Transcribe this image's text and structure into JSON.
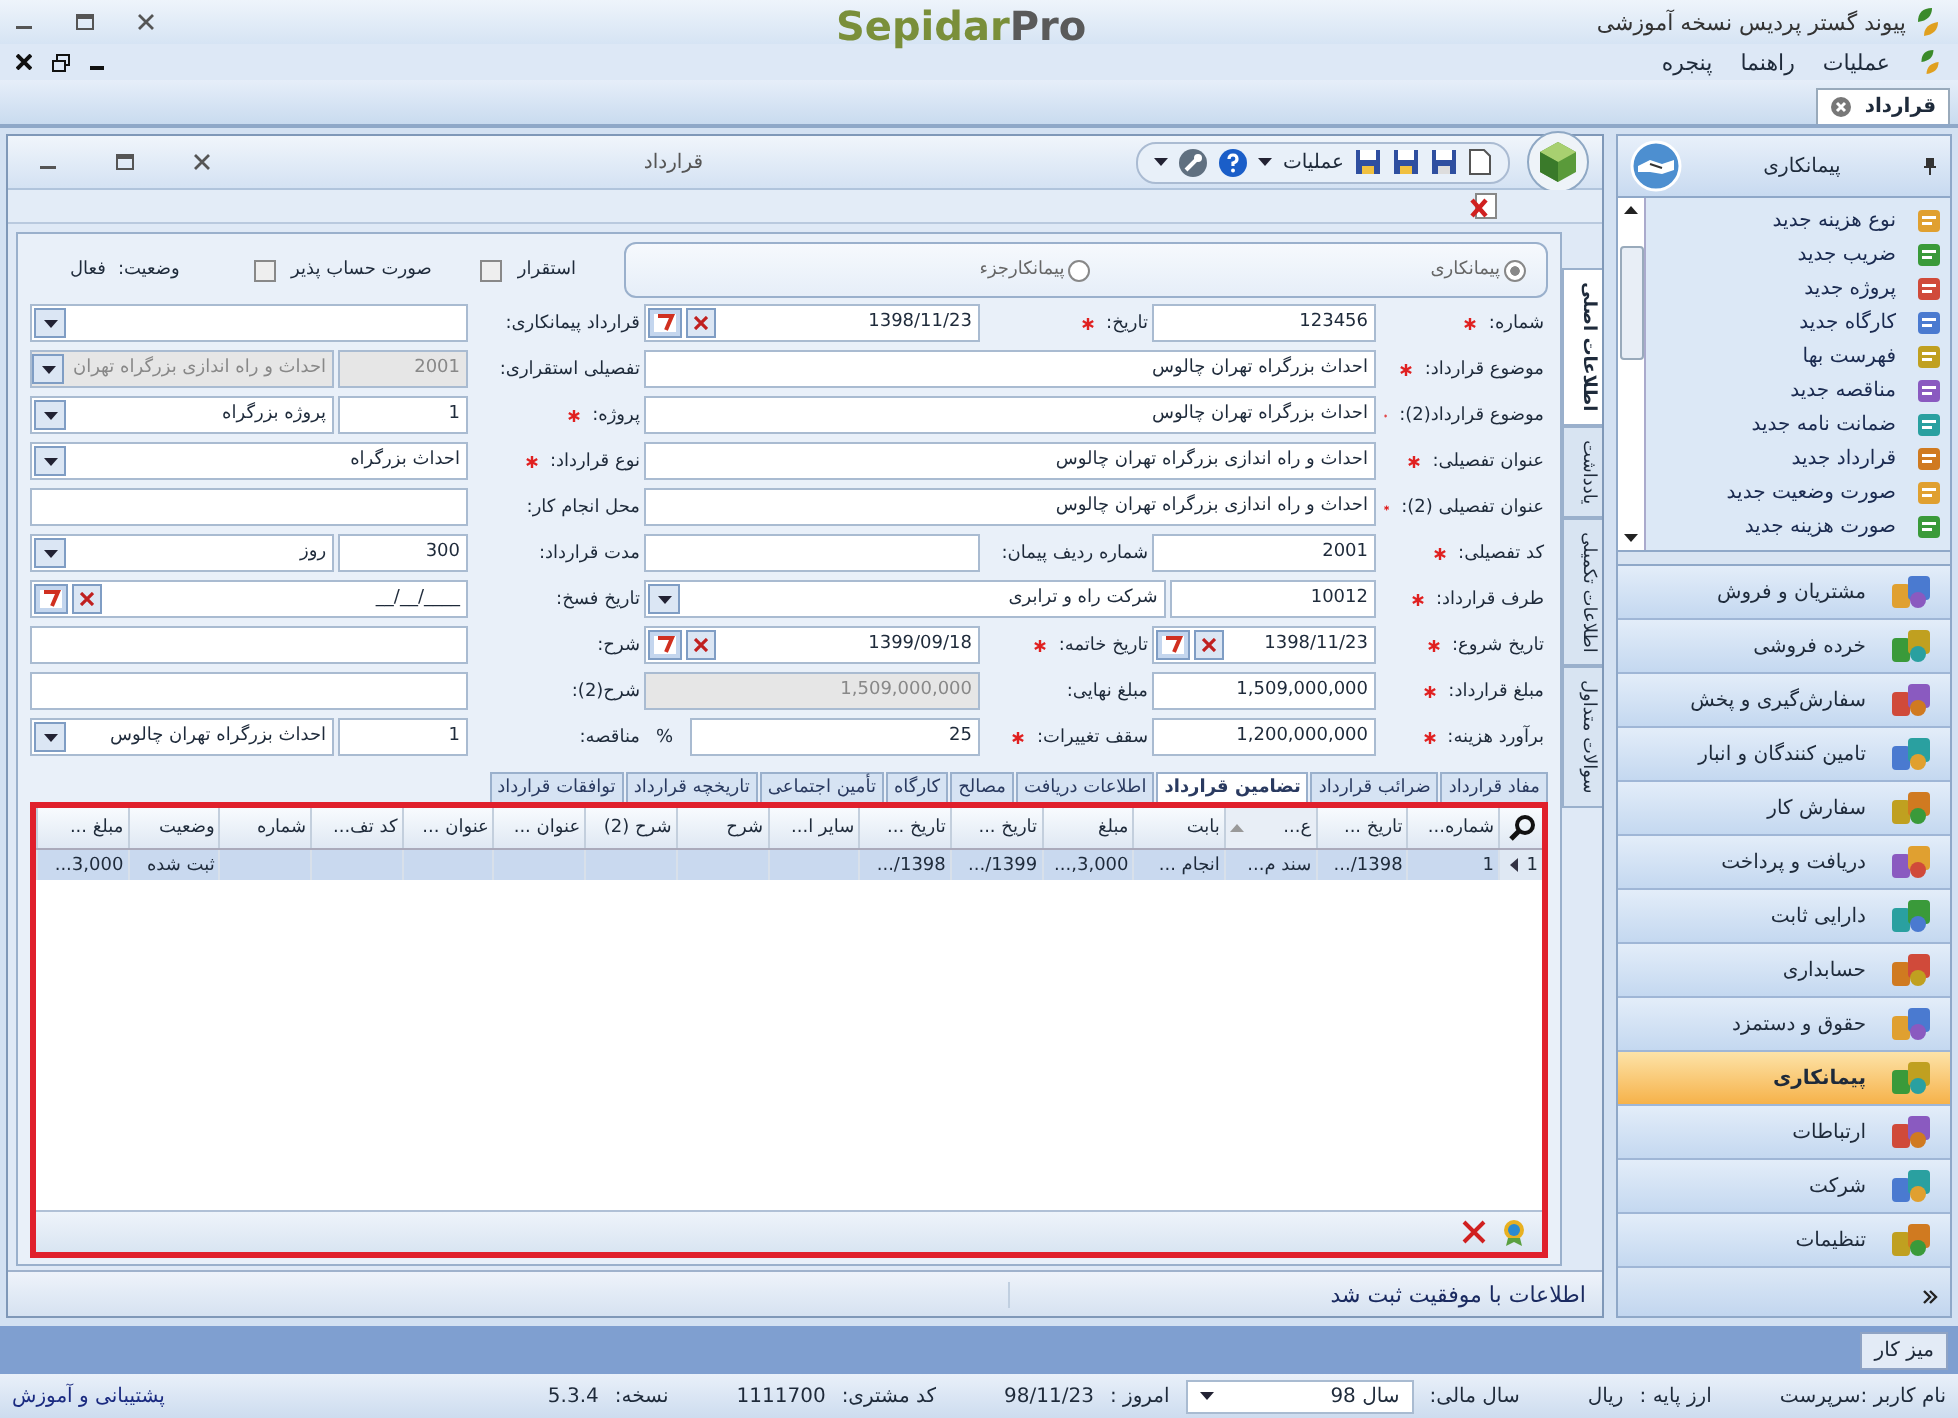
{
  "app_title": "پیوند گستر پردیس نسخه آموزشی",
  "brand": {
    "first": "Sepidar",
    "second": "Pro"
  },
  "menu": [
    "عملیات",
    "راهنما",
    "پنجره"
  ],
  "doc_tabs": [
    {
      "label": "قرارداد",
      "selected": true
    }
  ],
  "form": {
    "title": "قرارداد",
    "toolbar_menu": "عملیات",
    "contract_types": [
      {
        "label": "پیمانکاری",
        "selected": true
      },
      {
        "label": "پیمانکارجزء",
        "selected": false
      }
    ],
    "flags": [
      {
        "label": "استقرار",
        "checked": false
      },
      {
        "label": "صورت حساب پذیر",
        "checked": false
      }
    ],
    "status": {
      "label": "وضعیت:",
      "value": "فعال"
    },
    "rows": [
      [
        {
          "label": "شماره:",
          "required": true,
          "kind": "text",
          "disabled": false,
          "value": "123456"
        },
        {
          "label": "تاریخ:",
          "required": true,
          "kind": "date",
          "disabled": false,
          "value": "1398/11/23"
        },
        {
          "label": "قرارداد پیمانکاری:",
          "required": false,
          "kind": "combo",
          "disabled": false
        }
      ],
      [
        {
          "label": "موضوع قرارداد:",
          "required": true,
          "kind": "text",
          "disabled": false,
          "value": "احداث بزرگراه تهران چالوس"
        },
        {
          "label": "تفصیلی استقراری:",
          "required": false,
          "kind": "code_combo",
          "disabled": true,
          "code": "2001",
          "value": "احداث و راه اندازی بزرگراه تهران"
        }
      ],
      [
        {
          "label": "موضوع قرارداد(2):",
          "required": true,
          "kind": "text",
          "disabled": false,
          "value": "احداث بزرگراه تهران چالوس"
        },
        {
          "label": "پروژه:",
          "required": true,
          "kind": "code_combo",
          "disabled": false,
          "code": "1",
          "value": "پروژه بزرگراه"
        }
      ],
      [
        {
          "label": "عنوان تفصیلی:",
          "required": true,
          "kind": "text",
          "disabled": false,
          "value": "احداث و راه اندازی بزرگراه تهران چالوس"
        },
        {
          "label": "نوع قرارداد:",
          "required": true,
          "kind": "combo",
          "disabled": false,
          "value": "احداث بزرگراه"
        }
      ],
      [
        {
          "label": "عنوان تفصیلی (2):",
          "required": true,
          "kind": "text",
          "disabled": false,
          "value": "احداث و راه اندازی بزرگراه تهران چالوس"
        },
        {
          "label": "محل انجام کار:",
          "required": false,
          "kind": "text",
          "disabled": false
        }
      ],
      [
        {
          "label": "کد تفصیلی:",
          "required": true,
          "kind": "text",
          "disabled": false,
          "value": "2001"
        },
        {
          "label": "شماره ردیف پیمان:",
          "required": false,
          "kind": "text",
          "disabled": false
        },
        {
          "label": "مدت قرارداد:",
          "required": false,
          "kind": "code_combo",
          "disabled": false,
          "code": "300",
          "value": "روز"
        }
      ],
      [
        {
          "label": "طرف قرارداد:",
          "required": true,
          "kind": "code_combo",
          "disabled": false,
          "code": "10012",
          "value": "شرکت راه و ترابری"
        },
        {
          "label": "تاریخ فسخ:",
          "required": false,
          "kind": "date",
          "disabled": false,
          "value": "__/__/____"
        }
      ],
      [
        {
          "label": "تاریخ شروع:",
          "required": true,
          "kind": "date",
          "disabled": false,
          "value": "1398/11/23"
        },
        {
          "label": "تاریخ خاتمه:",
          "required": true,
          "kind": "date",
          "disabled": false,
          "value": "1399/09/18"
        },
        {
          "label": "شرح:",
          "required": false,
          "kind": "text",
          "disabled": false
        }
      ],
      [
        {
          "label": "مبلغ قرارداد:",
          "required": true,
          "kind": "text",
          "disabled": false,
          "value": "1,509,000,000"
        },
        {
          "label": "مبلغ نهایی:",
          "required": false,
          "kind": "text",
          "disabled": true,
          "value": "1,509,000,000"
        },
        {
          "label": "شرح(2):",
          "required": false,
          "kind": "text",
          "disabled": false
        }
      ],
      [
        {
          "label": "برآورد هزینه:",
          "required": true,
          "kind": "text",
          "disabled": false,
          "value": "1,200,000,000"
        },
        {
          "label": "سقف تغییرات:",
          "required": true,
          "kind": "text",
          "disabled": false,
          "value": "25",
          "suffix": "%"
        },
        {
          "label": "مناقصه:",
          "required": false,
          "kind": "code_combo",
          "disabled": false,
          "code": "1",
          "value": "احداث بزرگراه تهران چالوس"
        }
      ]
    ],
    "side_tabs": [
      {
        "label": "اطلاعات اصلی",
        "selected": true
      },
      {
        "label": "یادداشت",
        "selected": false
      },
      {
        "label": "اطلاعات تکمیلی",
        "selected": false
      },
      {
        "label": "سوالات متداول",
        "selected": false
      }
    ],
    "tabs": [
      {
        "label": "مفاد قرارداد",
        "selected": false
      },
      {
        "label": "ضرائب قرارداد",
        "selected": false
      },
      {
        "label": "تضامین قرارداد",
        "selected": true
      },
      {
        "label": "اطلاعات دریافت",
        "selected": false
      },
      {
        "label": "مصالح",
        "selected": false
      },
      {
        "label": "کارگاه",
        "selected": false
      },
      {
        "label": "تأمین اجتماعی",
        "selected": false
      },
      {
        "label": "تاریخچه قرارداد",
        "selected": false
      },
      {
        "label": "توافقات قرارداد",
        "selected": false
      }
    ],
    "grid": {
      "columns": [
        {
          "label": "شماره...",
          "sorted": false
        },
        {
          "label": "تاریخ ...",
          "sorted": false
        },
        {
          "label": "ع...",
          "sorted": true
        },
        {
          "label": "بابت",
          "sorted": false
        },
        {
          "label": "مبلغ",
          "sorted": false
        },
        {
          "label": "تاریخ ...",
          "sorted": false
        },
        {
          "label": "تاریخ ...",
          "sorted": false
        },
        {
          "label": "سایر ا...",
          "sorted": false
        },
        {
          "label": "شرح",
          "sorted": false
        },
        {
          "label": "شرح (2)",
          "sorted": false
        },
        {
          "label": "عنوان ...",
          "sorted": false
        },
        {
          "label": "عنوان ...",
          "sorted": false
        },
        {
          "label": "کد تف...",
          "sorted": false
        },
        {
          "label": "شماره",
          "sorted": false
        },
        {
          "label": "وضعیت",
          "sorted": false
        },
        {
          "label": "مبلغ ...",
          "sorted": false
        }
      ],
      "rows": [
        {
          "number": "1",
          "selected": true,
          "cells": [
            "1",
            "1398/...",
            "سند م...",
            "انجام ...",
            "3,000,...",
            "1399/...",
            "1398/...",
            null,
            null,
            null,
            null,
            null,
            null,
            null,
            "ثبت شده",
            "3,000..."
          ]
        }
      ]
    },
    "message": "اطلاعات با موفقیت ثبت شد"
  },
  "sidebar": {
    "title": "پیمانکاری",
    "shortcuts": [
      "نوع هزینه جدید",
      "ضریب جدید",
      "پروژه جدید",
      "کارگاه جدید",
      "فهرست بها",
      "مناقصه جدید",
      "ضمانت نامه جدید",
      "قرارداد جدید",
      "صورت وضعیت جدید",
      "صورت هزینه جدید"
    ],
    "groups": [
      {
        "label": "مشتریان و فروش",
        "selected": false
      },
      {
        "label": "خرده فروشی",
        "selected": false
      },
      {
        "label": "سفارش‌گیری و پخش",
        "selected": false
      },
      {
        "label": "تامین کنندگان و انبار",
        "selected": false
      },
      {
        "label": "سفارش کار",
        "selected": false
      },
      {
        "label": "دریافت و پرداخت",
        "selected": false
      },
      {
        "label": "دارایی ثابت",
        "selected": false
      },
      {
        "label": "حسابداری",
        "selected": false
      },
      {
        "label": "حقوق و دستمزد",
        "selected": false
      },
      {
        "label": "پیمانکاری",
        "selected": true
      },
      {
        "label": "ارتباطات",
        "selected": false
      },
      {
        "label": "شرکت",
        "selected": false
      },
      {
        "label": "تنظیمات",
        "selected": false
      }
    ]
  },
  "taskbar": [
    "میز کار"
  ],
  "status_bar": {
    "user": "نام کاربر :سرپرست",
    "currency_label": "ارز پایه :",
    "currency": "ریال",
    "year_label": "سال مالی:",
    "year": "سال 98",
    "today_label": "امروز :",
    "today": "98/11/23",
    "customer_label": "کد مشتری:",
    "customer": "1111700",
    "version_label": "نسخه:",
    "version": "5.3.4",
    "support": "پشتیبانی و آموزش"
  }
}
